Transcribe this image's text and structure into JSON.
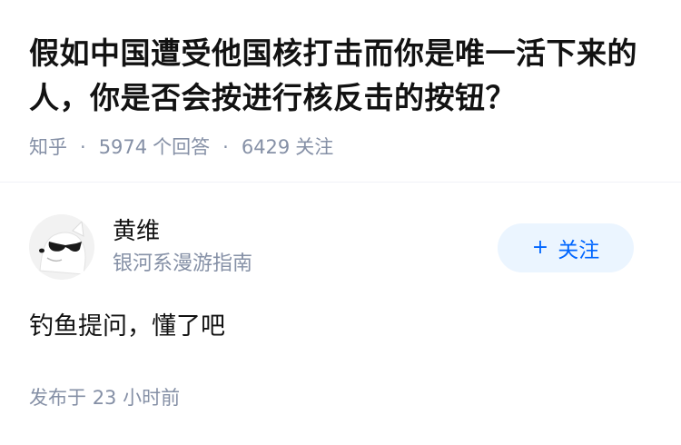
{
  "question": {
    "title": "假如中国遭受他国核打击而你是唯一活下来的人，你是否会按进行核反击的按钮？",
    "source": "知乎",
    "answer_count": "5974",
    "answer_label": "个回答",
    "follower_count": "6429",
    "follower_label": "关注"
  },
  "author": {
    "name": "黄维",
    "bio": "银河系漫游指南",
    "avatar_icon": "cartoon-dog-sunglasses-icon"
  },
  "follow_button": {
    "icon": "plus-icon",
    "plus": "+",
    "label": "关注",
    "color": "#0066ff",
    "background": "#ebf5ff"
  },
  "answer": {
    "content": "钓鱼提问，懂了吧",
    "time_prefix": "发布于",
    "time_value": "23",
    "time_unit": "小时前"
  },
  "colors": {
    "text": "#121212",
    "meta": "#8590a6",
    "divider": "#f0f2f7"
  }
}
